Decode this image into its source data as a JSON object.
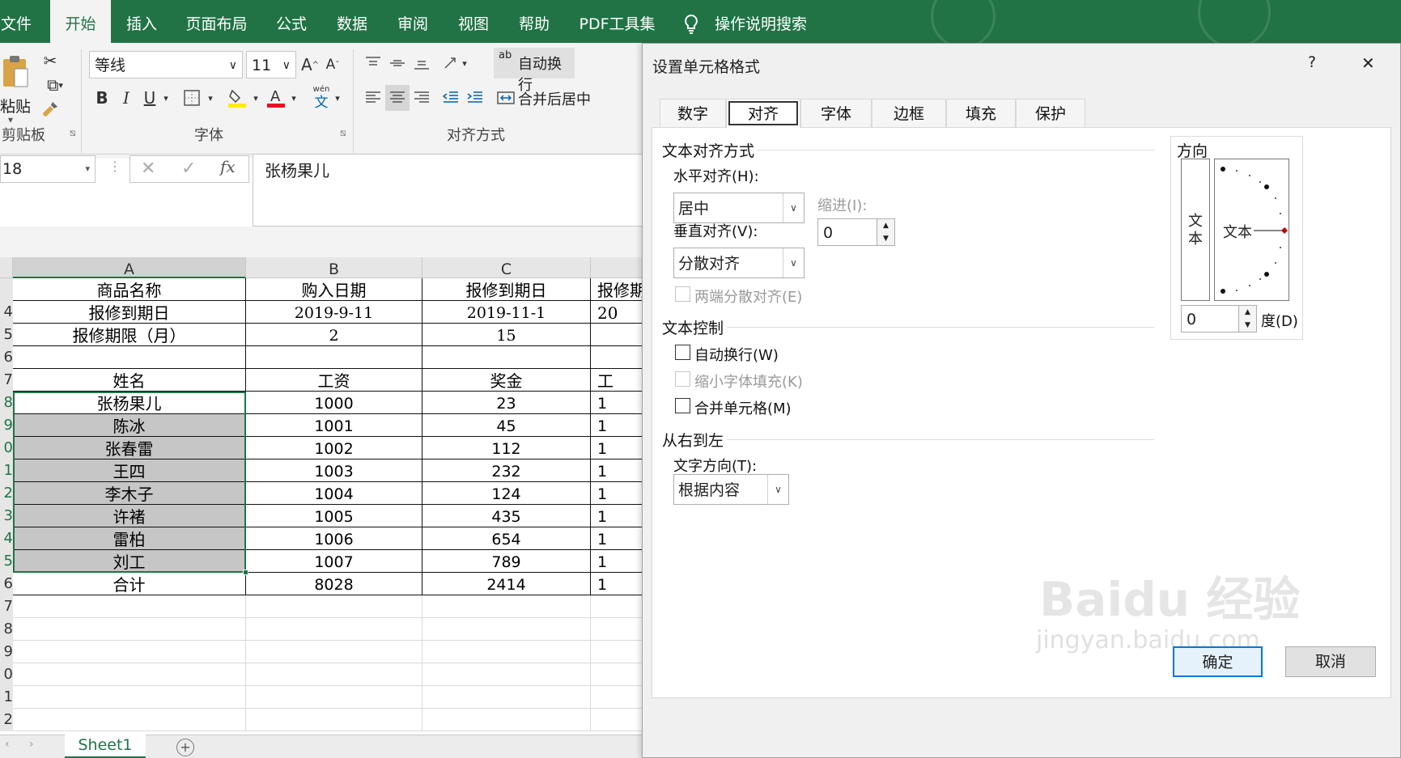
{
  "ribbon_tabs": [
    "文件",
    "开始",
    "插入",
    "页面布局",
    "公式",
    "数据",
    "审阅",
    "视图",
    "帮助",
    "PDF工具集"
  ],
  "tell_me": "操作说明搜索",
  "clipboard": {
    "paste": "粘贴",
    "group": "剪贴板"
  },
  "font_group": {
    "font_name": "等线",
    "font_size": "11",
    "bold": "B",
    "italic": "I",
    "underline": "U",
    "group": "字体",
    "grow": "A",
    "shrink": "A",
    "wen_top": "wén",
    "wen": "文"
  },
  "align_group": {
    "wrap": "自动换行",
    "merge": "合并后居中",
    "group": "对齐方式",
    "ab": "ab"
  },
  "formula_bar": {
    "name_box": "18",
    "fx": "fx",
    "content": "张杨果儿"
  },
  "columns": [
    "A",
    "B",
    "C"
  ],
  "rows": [
    {
      "num": "",
      "cells": [
        "商品名称",
        "购入日期",
        "报修到期日",
        "报修期"
      ]
    },
    {
      "num": "4",
      "cells": [
        "报修到期日",
        "2019-9-11",
        "2019-11-1",
        "20"
      ]
    },
    {
      "num": "5",
      "cells": [
        "报修期限（月）",
        "2",
        "15",
        ""
      ]
    },
    {
      "num": "6",
      "cells": [
        "",
        "",
        "",
        ""
      ]
    },
    {
      "num": "7",
      "cells": [
        "姓名",
        "工资",
        "奖金",
        "工"
      ]
    },
    {
      "num": "8",
      "cells": [
        "张杨果儿",
        "1000",
        "23",
        "1"
      ]
    },
    {
      "num": "9",
      "cells": [
        "陈冰",
        "1001",
        "45",
        "1"
      ]
    },
    {
      "num": "0",
      "cells": [
        "张春雷",
        "1002",
        "112",
        "1"
      ]
    },
    {
      "num": "1",
      "cells": [
        "王四",
        "1003",
        "232",
        "1"
      ]
    },
    {
      "num": "2",
      "cells": [
        "李木子",
        "1004",
        "124",
        "1"
      ]
    },
    {
      "num": "3",
      "cells": [
        "许褚",
        "1005",
        "435",
        "1"
      ]
    },
    {
      "num": "4",
      "cells": [
        "雷柏",
        "1006",
        "654",
        "1"
      ]
    },
    {
      "num": "5",
      "cells": [
        "刘工",
        "1007",
        "789",
        "1"
      ]
    },
    {
      "num": "6",
      "cells": [
        "合计",
        "8028",
        "2414",
        "1"
      ]
    },
    {
      "num": "7",
      "cells": [
        "",
        "",
        "",
        ""
      ]
    },
    {
      "num": "8",
      "cells": [
        "",
        "",
        "",
        ""
      ]
    },
    {
      "num": "9",
      "cells": [
        "",
        "",
        "",
        ""
      ]
    },
    {
      "num": "0",
      "cells": [
        "",
        "",
        "",
        ""
      ]
    },
    {
      "num": "1",
      "cells": [
        "",
        "",
        "",
        ""
      ]
    },
    {
      "num": "2",
      "cells": [
        "",
        "",
        "",
        ""
      ]
    }
  ],
  "sheet_tab": "Sheet1",
  "add_sheet": "+",
  "dialog": {
    "title": "设置单元格格式",
    "help": "?",
    "close": "✕",
    "tabs": [
      "数字",
      "对齐",
      "字体",
      "边框",
      "填充",
      "保护"
    ],
    "text_alignment": "文本对齐方式",
    "horizontal_label": "水平对齐(H):",
    "horizontal_value": "居中",
    "indent_label": "缩进(I):",
    "indent_value": "0",
    "vertical_label": "垂直对齐(V):",
    "vertical_value": "分散对齐",
    "justify_distributed": "两端分散对齐(E)",
    "text_control": "文本控制",
    "wrap_text": "自动换行(W)",
    "shrink_to_fit": "缩小字体填充(K)",
    "merge_cells": "合并单元格(M)",
    "rtl": "从右到左",
    "text_direction_label": "文字方向(T):",
    "text_direction_value": "根据内容",
    "orientation": "方向",
    "vertical_text": "文本",
    "orient_text": "文本",
    "degree_value": "0",
    "degree_label": "度(D)",
    "ok": "确定",
    "cancel": "取消"
  },
  "watermark": {
    "brand": "Baidu 经验",
    "url": "jingyan.baidu.com"
  },
  "colors": {
    "excel_green": "#217346",
    "selection_fill": "#c6c6c6",
    "accent_blue": "#0078d7"
  }
}
